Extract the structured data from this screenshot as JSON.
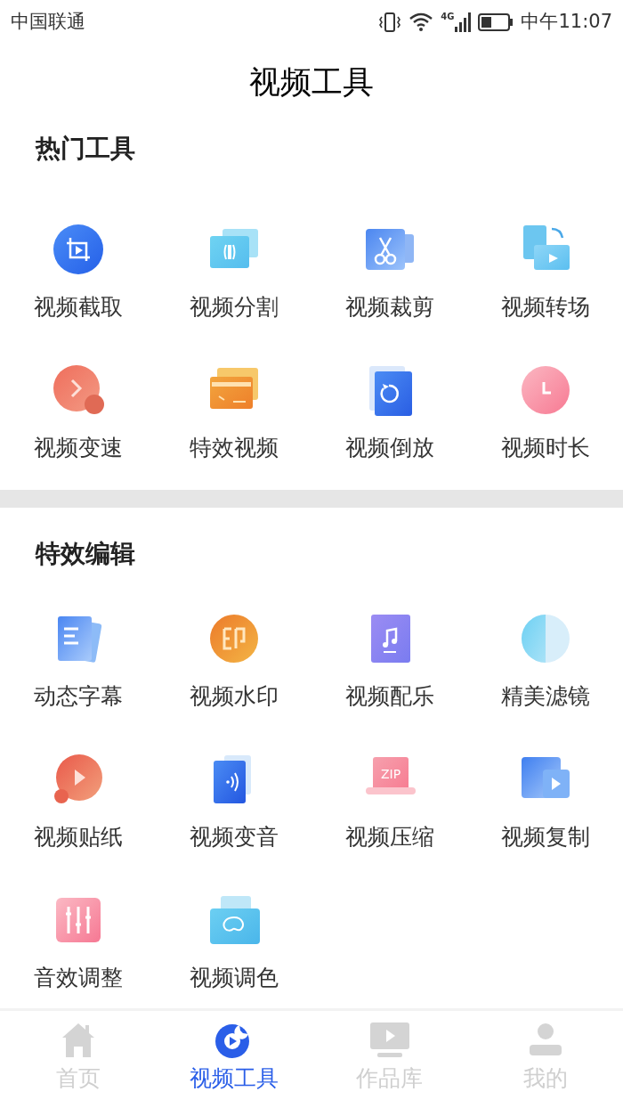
{
  "status_bar": {
    "carrier": "中国联通",
    "network": "4G",
    "time": "中午11:07"
  },
  "title": "视频工具",
  "sections": [
    {
      "heading": "热门工具",
      "items": [
        {
          "label": "视频截取"
        },
        {
          "label": "视频分割"
        },
        {
          "label": "视频裁剪"
        },
        {
          "label": "视频转场"
        },
        {
          "label": "视频变速"
        },
        {
          "label": "特效视频"
        },
        {
          "label": "视频倒放"
        },
        {
          "label": "视频时长"
        }
      ]
    },
    {
      "heading": "特效编辑",
      "items": [
        {
          "label": "动态字幕"
        },
        {
          "label": "视频水印"
        },
        {
          "label": "视频配乐"
        },
        {
          "label": "精美滤镜"
        },
        {
          "label": "视频贴纸"
        },
        {
          "label": "视频变音"
        },
        {
          "label": "视频压缩",
          "badge": "ZIP"
        },
        {
          "label": "视频复制"
        },
        {
          "label": "音效调整"
        },
        {
          "label": "视频调色"
        }
      ]
    }
  ],
  "tabs": [
    {
      "label": "首页",
      "selected": false
    },
    {
      "label": "视频工具",
      "selected": true
    },
    {
      "label": "作品库",
      "selected": false
    },
    {
      "label": "我的",
      "selected": false
    }
  ]
}
